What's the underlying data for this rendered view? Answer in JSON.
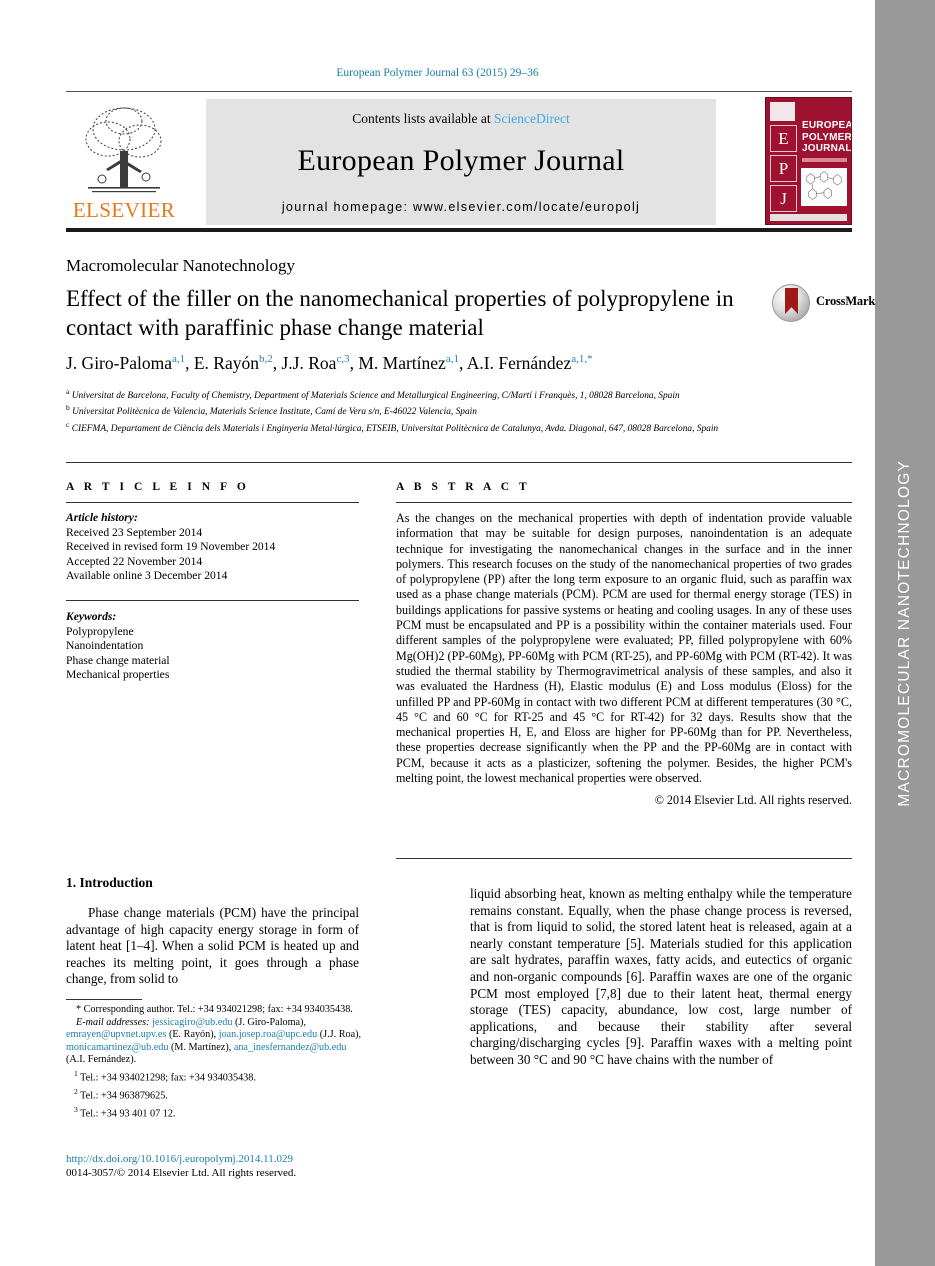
{
  "running_head": "European Polymer Journal 63 (2015) 29–36",
  "masthead": {
    "contents_prefix": "Contents lists available at ",
    "contents_link": "ScienceDirect",
    "journal_name": "European Polymer Journal",
    "homepage": "journal homepage: www.elsevier.com/locate/europolj",
    "publisher": "ELSEVIER",
    "cover": {
      "letters": [
        "E",
        "P",
        "J"
      ],
      "title_lines": [
        "EUROPEAN",
        "POLYMER",
        "JOURNAL"
      ]
    }
  },
  "side_band": {
    "label": "MACROMOLECULAR NANOTECHNOLOGY",
    "background": "#999999",
    "text_color": "#ffffff"
  },
  "article": {
    "section_label": "Macromolecular Nanotechnology",
    "title": "Effect of the filler on the nanomechanical properties of polypropylene in contact with paraffinic phase change material",
    "crossmark_label": "CrossMark",
    "authors": [
      {
        "name": "J. Giro-Paloma",
        "sup": "a,1"
      },
      {
        "name": "E. Rayón",
        "sup": "b,2"
      },
      {
        "name": "J.J. Roa",
        "sup": "c,3"
      },
      {
        "name": "M. Martínez",
        "sup": "a,1"
      },
      {
        "name": "A.I. Fernández",
        "sup": "a,1,*"
      }
    ],
    "affiliations": [
      {
        "marker": "a",
        "text": "Universitat de Barcelona, Faculty of Chemistry, Department of Materials Science and Metallurgical Engineering, C/Martí i Franquès, 1, 08028 Barcelona, Spain"
      },
      {
        "marker": "b",
        "text": "Universitat Politècnica de Valencia, Materials Science Institute, Camí de Vera s/n, E-46022 Valencia, Spain"
      },
      {
        "marker": "c",
        "text": "CIEFMA, Departament de Ciència dels Materials i Enginyeria Metal·lúrgica, ETSEIB, Universitat Politècnica de Catalunya, Avda. Diagonal, 647, 08028 Barcelona, Spain"
      }
    ]
  },
  "article_info": {
    "heading": "A R T I C L E    I N F O",
    "history_label": "Article history:",
    "history": [
      "Received 23 September 2014",
      "Received in revised form 19 November 2014",
      "Accepted 22 November 2014",
      "Available online 3 December 2014"
    ],
    "keywords_label": "Keywords:",
    "keywords": [
      "Polypropylene",
      "Nanoindentation",
      "Phase change material",
      "Mechanical properties"
    ]
  },
  "abstract": {
    "heading": "A B S T R A C T",
    "body": "As the changes on the mechanical properties with depth of indentation provide valuable information that may be suitable for design purposes, nanoindentation is an adequate technique for investigating the nanomechanical changes in the surface and in the inner polymers. This research focuses on the study of the nanomechanical properties of two grades of polypropylene (PP) after the long term exposure to an organic fluid, such as paraffin wax used as a phase change materials (PCM). PCM are used for thermal energy storage (TES) in buildings applications for passive systems or heating and cooling usages. In any of these uses PCM must be encapsulated and PP is a possibility within the container materials used. Four different samples of the polypropylene were evaluated; PP, filled polypropylene with 60% Mg(OH)2 (PP-60Mg), PP-60Mg with PCM (RT-25), and PP-60Mg with PCM (RT-42). It was studied the thermal stability by Thermogravimetrical analysis of these samples, and also it was evaluated the Hardness (H), Elastic modulus (E) and Loss modulus (Eloss) for the unfilled PP and PP-60Mg in contact with two different PCM at different temperatures (30 °C, 45 °C and 60 °C for RT-25 and 45 °C for RT-42) for 32 days. Results show that the mechanical properties H, E, and Eloss are higher for PP-60Mg than for PP. Nevertheless, these properties decrease significantly when the PP and the PP-60Mg are in contact with PCM, because it acts as a plasticizer, softening the polymer. Besides, the higher PCM's melting point, the lowest mechanical properties were observed.",
    "copyright": "© 2014 Elsevier Ltd. All rights reserved."
  },
  "introduction": {
    "heading": "1. Introduction",
    "left_paragraph": "Phase change materials (PCM) have the principal advantage of high capacity energy storage in form of latent heat [1–4]. When a solid PCM is heated up and reaches its melting point, it goes through a phase change, from solid to",
    "right_paragraph": "liquid absorbing heat, known as melting enthalpy while the temperature remains constant. Equally, when the phase change process is reversed, that is from liquid to solid, the stored latent heat is released, again at a nearly constant temperature [5]. Materials studied for this application are salt hydrates, paraffin waxes, fatty acids, and eutectics of organic and non-organic compounds [6]. Paraffin waxes are one of the organic PCM most employed [7,8] due to their latent heat, thermal energy storage (TES) capacity, abundance, low cost, large number of applications, and because their stability after several charging/discharging cycles [9]. Paraffin waxes with a melting point between 30 °C and 90 °C have chains with the number of"
  },
  "footnotes": {
    "corresponding": "* Corresponding author. Tel.: +34 934021298; fax: +34 934035438.",
    "email_label": "E-mail addresses:",
    "emails": [
      {
        "address": "jessicagiro@ub.edu",
        "person": "(J. Giro-Paloma),"
      },
      {
        "address": "emrayen@upvnet.upv.es",
        "person": "(E. Rayón),"
      },
      {
        "address": "joan.josep.roa@upc.edu",
        "person": "(J.J. Roa),"
      },
      {
        "address": "monicamartinez@ub.edu",
        "person": "(M. Martínez),"
      },
      {
        "address": "ana_inesfernandez@ub.edu",
        "person": "(A.I. Fernández)."
      }
    ],
    "tels": [
      {
        "marker": "1",
        "text": "Tel.: +34 934021298; fax: +34 934035438."
      },
      {
        "marker": "2",
        "text": "Tel.: +34 963879625."
      },
      {
        "marker": "3",
        "text": "Tel.: +34 93 401 07 12."
      }
    ]
  },
  "doi": {
    "url": "http://dx.doi.org/10.1016/j.europolymj.2014.11.029",
    "issn_line": "0014-3057/© 2014 Elsevier Ltd. All rights reserved."
  },
  "colors": {
    "link": "#1a7fa8",
    "sciencedirect": "#3fa9dd",
    "elsevier_orange": "#e77817",
    "cover_red": "#9e1230"
  }
}
